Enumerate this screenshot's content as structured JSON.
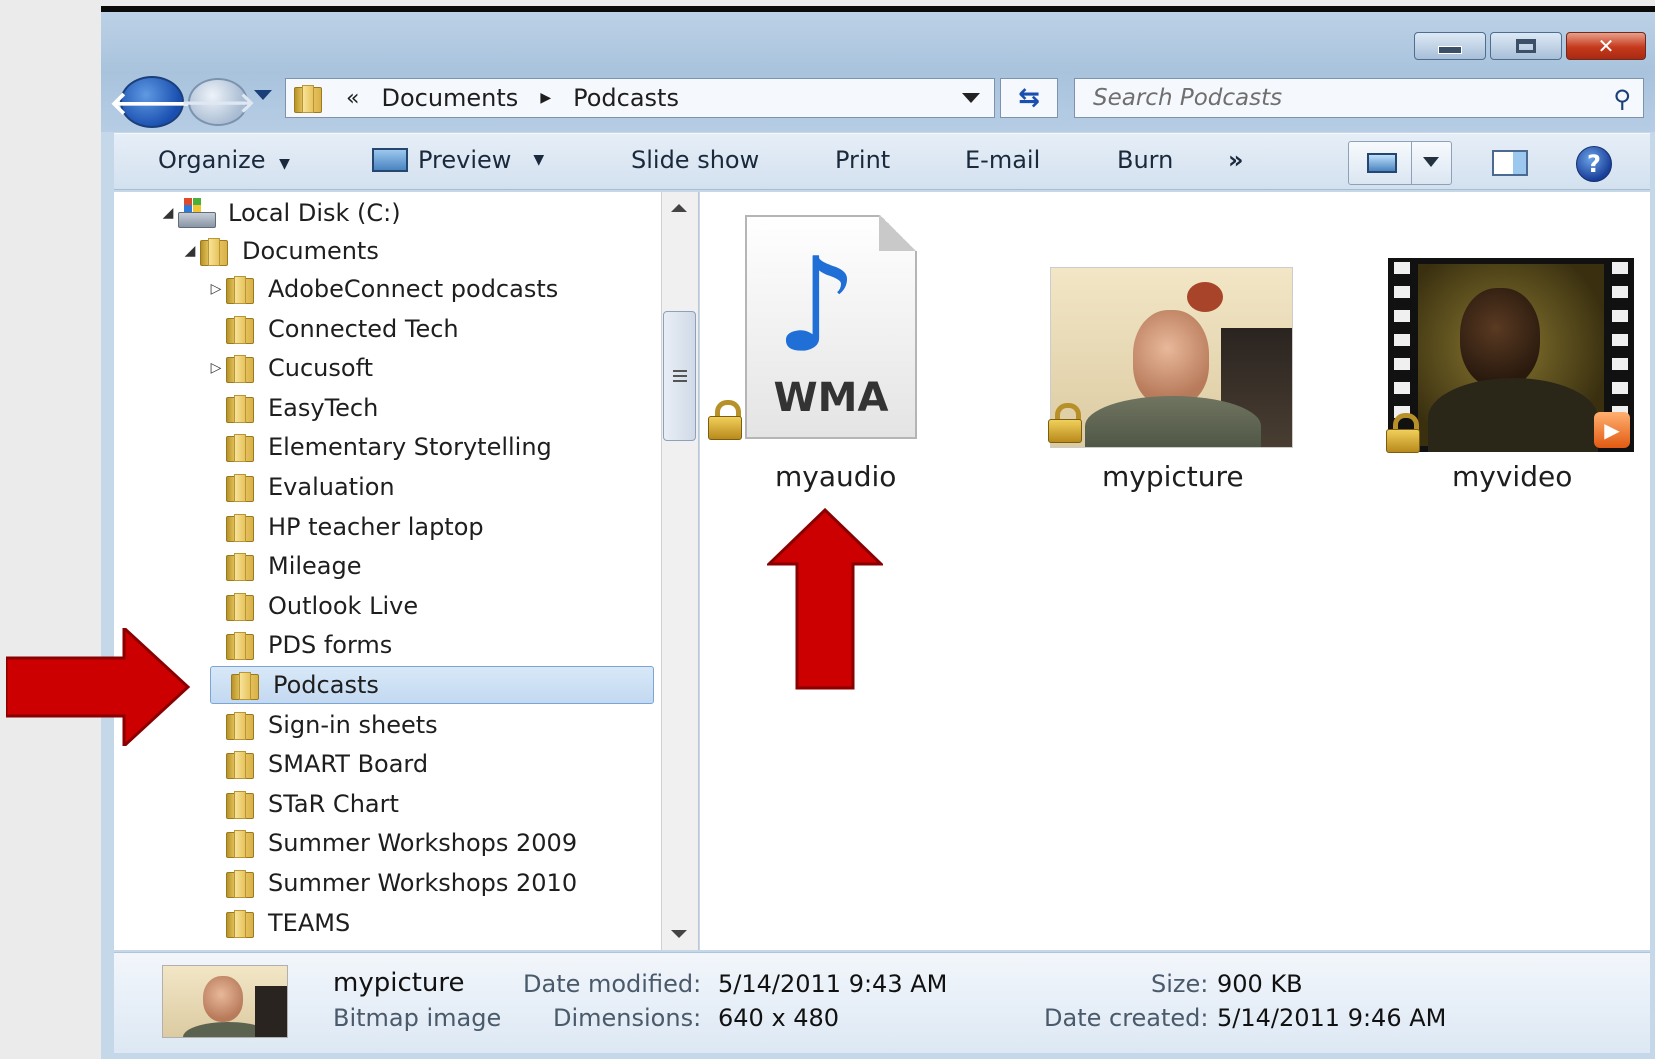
{
  "address": {
    "segments": [
      "Documents",
      "Podcasts"
    ],
    "overflow": "«"
  },
  "search": {
    "placeholder": "Search Podcasts"
  },
  "toolbar": {
    "organize": "Organize",
    "preview": "Preview",
    "slideshow": "Slide show",
    "print": "Print",
    "email": "E-mail",
    "burn": "Burn",
    "more": "»"
  },
  "tree": {
    "root": "Local Disk (C:)",
    "documents": "Documents",
    "items": [
      {
        "label": "AdobeConnect podcasts",
        "expandable": true
      },
      {
        "label": "Connected Tech",
        "expandable": false
      },
      {
        "label": "Cucusoft",
        "expandable": true
      },
      {
        "label": "EasyTech",
        "expandable": false
      },
      {
        "label": "Elementary Storytelling",
        "expandable": false
      },
      {
        "label": "Evaluation",
        "expandable": false
      },
      {
        "label": "HP teacher laptop",
        "expandable": false
      },
      {
        "label": "Mileage",
        "expandable": false
      },
      {
        "label": "Outlook Live",
        "expandable": false
      },
      {
        "label": "PDS forms",
        "expandable": false
      },
      {
        "label": "Podcasts",
        "expandable": false,
        "selected": true
      },
      {
        "label": "Sign-in sheets",
        "expandable": false
      },
      {
        "label": "SMART Board",
        "expandable": false
      },
      {
        "label": "STaR Chart",
        "expandable": false
      },
      {
        "label": "Summer Workshops 2009",
        "expandable": false
      },
      {
        "label": "Summer Workshops 2010",
        "expandable": false
      },
      {
        "label": "TEAMS",
        "expandable": false
      }
    ]
  },
  "files": [
    {
      "name": "myaudio",
      "type_badge": "WMA",
      "icon": "music-note-icon"
    },
    {
      "name": "mypicture",
      "icon": "photo-thumbnail"
    },
    {
      "name": "myvideo",
      "icon": "video-thumbnail"
    }
  ],
  "details": {
    "name": "mypicture",
    "type": "Bitmap image",
    "date_modified_label": "Date modified:",
    "date_modified": "5/14/2011 9:43 AM",
    "dimensions_label": "Dimensions:",
    "dimensions": "640 x 480",
    "size_label": "Size:",
    "size": "900 KB",
    "date_created_label": "Date created:",
    "date_created": "5/14/2011 9:46 AM"
  },
  "colors": {
    "annotation_arrow": "#cc0000",
    "selection": "#c3d9f1",
    "chrome": "#b6cde4"
  }
}
